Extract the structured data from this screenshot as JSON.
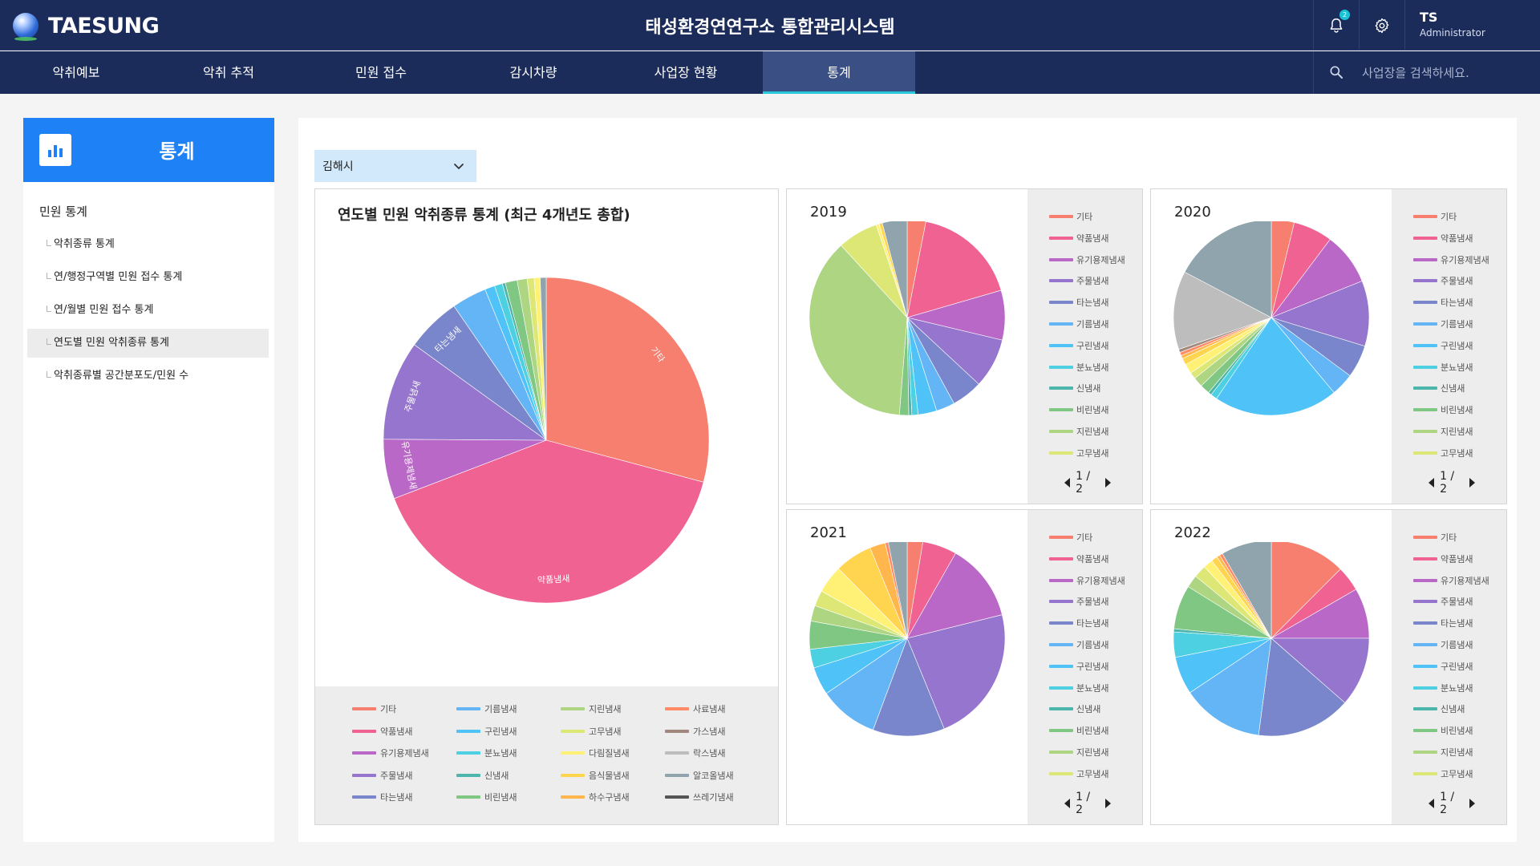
{
  "header": {
    "logo_text": "TAESUNG",
    "title": "태성환경연연구소 통합관리시스템",
    "notification_count": "2",
    "user_initials": "TS",
    "user_role": "Administrator"
  },
  "nav": {
    "items": [
      "악취예보",
      "악취 추적",
      "민원 접수",
      "감시차량",
      "사업장 현황",
      "통계"
    ],
    "active_index": 5,
    "search_placeholder": "사업장을 검색하세요."
  },
  "sidebar": {
    "title": "통계",
    "section": "민원 통계",
    "items": [
      "악취종류 통계",
      "연/행정구역별 민원 접수 통계",
      "연/월별 민원 접수 통계",
      "연도별 민원 악취종류 통계",
      "악취종류별 공간분포도/민원 수"
    ],
    "active_index": 3
  },
  "filter": {
    "region": "김해시"
  },
  "main_chart": {
    "title": "연도별 민원 악취종류 통계 (최근 4개년도 총합)"
  },
  "legend_pager": "1 / 2",
  "colors": {
    "header_bg": "#1b2c5a",
    "accent_blue": "#1e82f6",
    "active_tab_underline": "#28c8d8"
  },
  "odor_types": [
    {
      "name": "기타",
      "color": "#f67f6f"
    },
    {
      "name": "약품냄새",
      "color": "#f06292"
    },
    {
      "name": "유기용제냄새",
      "color": "#ba68c8"
    },
    {
      "name": "주물냄새",
      "color": "#9575cd"
    },
    {
      "name": "타는냄새",
      "color": "#7986cb"
    },
    {
      "name": "기름냄새",
      "color": "#64b5f6"
    },
    {
      "name": "구린냄새",
      "color": "#4fc3f7"
    },
    {
      "name": "분뇨냄새",
      "color": "#4dd0e1"
    },
    {
      "name": "신냄새",
      "color": "#4db6ac"
    },
    {
      "name": "비린냄새",
      "color": "#81c784"
    },
    {
      "name": "지린냄새",
      "color": "#aed581"
    },
    {
      "name": "고무냄새",
      "color": "#dce775"
    },
    {
      "name": "다림질냄새",
      "color": "#fff176"
    },
    {
      "name": "음식물냄새",
      "color": "#ffd54f"
    },
    {
      "name": "하수구냄새",
      "color": "#ffb74d"
    },
    {
      "name": "사료냄새",
      "color": "#ff8a65"
    },
    {
      "name": "가스냄새",
      "color": "#a1887f"
    },
    {
      "name": "락스냄새",
      "color": "#bdbdbd"
    },
    {
      "name": "알코올냄새",
      "color": "#90a4ae"
    },
    {
      "name": "쓰레기냄새",
      "color": "#555555"
    }
  ],
  "chart_data": [
    {
      "type": "pie",
      "title": "연도별 민원 악취종류 통계 (최근 4개년도 총합)",
      "categories": [
        "기타",
        "약품냄새",
        "유기용제냄새",
        "주물냄새",
        "타는냄새",
        "기름냄새",
        "구린냄새",
        "분뇨냄새",
        "신냄새",
        "비린냄새",
        "지린냄새",
        "고무냄새",
        "다림질냄새",
        "음식물냄새",
        "하수구냄새",
        "사료냄새",
        "가스냄새",
        "락스냄새",
        "알코올냄새",
        "쓰레기냄새"
      ],
      "values": [
        29.5,
        40.5,
        6.0,
        10.0,
        5.5,
        3.5,
        1.0,
        0.8,
        0.3,
        1.2,
        1.0,
        0.7,
        0.6,
        0,
        0,
        0,
        0,
        0,
        0.6,
        0
      ],
      "slice_labels": [
        "기타",
        "약품냄새",
        "유기용제냄새",
        "주물냄새",
        "타는냄새"
      ],
      "legend_position": "bottom"
    },
    {
      "type": "pie",
      "title": "2019",
      "categories": [
        "기타",
        "약품냄새",
        "유기용제냄새",
        "주물냄새",
        "타는냄새",
        "기름냄새",
        "구린냄새",
        "분뇨냄새",
        "신냄새",
        "비린냄새",
        "지린냄새",
        "고무냄새",
        "다림질냄새",
        "음식물냄새",
        "하수구냄새",
        "사료냄새",
        "가스냄새",
        "락스냄새",
        "알코올냄새",
        "쓰레기냄새"
      ],
      "values": [
        3.0,
        17.0,
        8.0,
        8.0,
        5.0,
        3.0,
        3.0,
        1.0,
        0.5,
        1.5,
        36.0,
        6.5,
        0.5,
        0.5,
        0,
        0,
        0,
        0,
        4.0,
        0
      ],
      "legend_position": "right"
    },
    {
      "type": "pie",
      "title": "2020",
      "categories": [
        "기타",
        "약품냄새",
        "유기용제냄새",
        "주물냄새",
        "타는냄새",
        "기름냄새",
        "구린냄새",
        "분뇨냄새",
        "신냄새",
        "비린냄새",
        "지린냄새",
        "고무냄새",
        "다림질냄새",
        "음식물냄새",
        "하수구냄새",
        "사료냄새",
        "가스냄새",
        "락스냄새",
        "알코올냄새",
        "쓰레기냄새"
      ],
      "values": [
        3.5,
        6.0,
        8.0,
        10.0,
        5.0,
        3.5,
        19.0,
        1.0,
        0.5,
        1.5,
        1.5,
        1.0,
        1.5,
        1.0,
        0.5,
        0.5,
        0.5,
        12.0,
        16.0,
        0
      ],
      "legend_position": "right"
    },
    {
      "type": "pie",
      "title": "2021",
      "categories": [
        "기타",
        "약품냄새",
        "유기용제냄새",
        "주물냄새",
        "타는냄새",
        "기름냄새",
        "구린냄새",
        "분뇨냄새",
        "신냄새",
        "비린냄새",
        "지린냄새",
        "고무냄새",
        "다림질냄새",
        "음식물냄새",
        "하수구냄새",
        "사료냄새",
        "가스냄새",
        "락스냄새",
        "알코올냄새",
        "쓰레기냄새"
      ],
      "values": [
        2.5,
        5.5,
        12.5,
        22.0,
        11.5,
        9.5,
        4.5,
        3.0,
        0,
        4.5,
        2.5,
        2.5,
        4.5,
        6.0,
        2.5,
        0.5,
        0,
        0,
        3.0,
        0
      ],
      "legend_position": "right"
    },
    {
      "type": "pie",
      "title": "2022",
      "categories": [
        "기타",
        "약품냄새",
        "유기용제냄새",
        "주물냄새",
        "타는냄새",
        "기름냄새",
        "구린냄새",
        "분뇨냄새",
        "신냄새",
        "비린냄새",
        "지린냄새",
        "고무냄새",
        "다림질냄새",
        "음식물냄새",
        "하수구냄새",
        "사료냄새",
        "가스냄새",
        "락스냄새",
        "알코올냄새",
        "쓰레기냄새"
      ],
      "values": [
        12.0,
        4.0,
        8.0,
        11.0,
        15.0,
        13.0,
        6.0,
        4.0,
        0.5,
        7.0,
        2.0,
        2.0,
        1.5,
        1.0,
        0.5,
        0.5,
        0,
        0,
        8.0,
        0
      ],
      "legend_position": "right"
    }
  ]
}
